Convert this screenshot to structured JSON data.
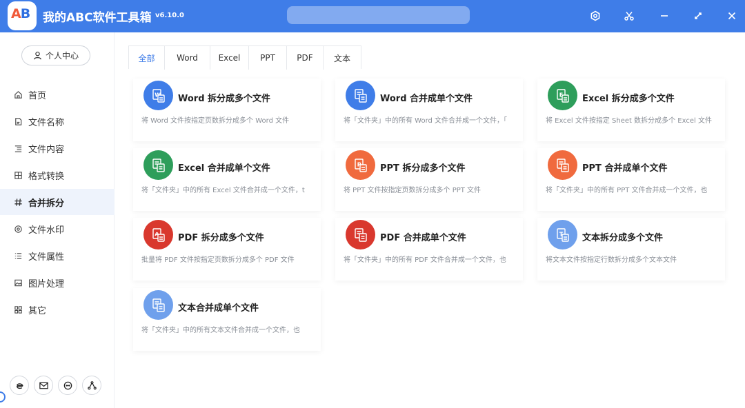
{
  "app": {
    "title": "我的ABC软件工具箱",
    "version": "v6.10.0",
    "logo_text_a": "A",
    "logo_text_b": "B",
    "accent": "#3F7DE8"
  },
  "titlebar_icons": [
    "settings-icon",
    "scissors-icon",
    "minimize-icon",
    "maximize-icon",
    "close-icon"
  ],
  "sidebar": {
    "user_center": "个人中心",
    "items": [
      {
        "label": "首页",
        "icon": "home-icon"
      },
      {
        "label": "文件名称",
        "icon": "file-name-icon"
      },
      {
        "label": "文件内容",
        "icon": "file-content-icon"
      },
      {
        "label": "格式转换",
        "icon": "format-convert-icon"
      },
      {
        "label": "合并拆分",
        "icon": "merge-split-icon",
        "active": true
      },
      {
        "label": "文件水印",
        "icon": "watermark-icon"
      },
      {
        "label": "文件属性",
        "icon": "file-properties-icon"
      },
      {
        "label": "图片处理",
        "icon": "image-process-icon"
      },
      {
        "label": "其它",
        "icon": "other-icon"
      }
    ],
    "bottom_icons": [
      "browser-icon",
      "mail-icon",
      "chat-icon",
      "share-icon"
    ]
  },
  "tabs": [
    {
      "label": "全部",
      "active": true
    },
    {
      "label": "Word"
    },
    {
      "label": "Excel"
    },
    {
      "label": "PPT"
    },
    {
      "label": "PDF"
    },
    {
      "label": "文本"
    }
  ],
  "cards": [
    {
      "title": "Word 拆分成多个文件",
      "desc": "将 Word 文件按指定页数拆分成多个 Word 文件",
      "color": "#3F7DE8",
      "icon": "word-split-icon"
    },
    {
      "title": "Word 合并成单个文件",
      "desc": "将「文件夹」中的所有 Word 文件合并成一个文件，「",
      "color": "#3F7DE8",
      "icon": "word-merge-icon"
    },
    {
      "title": "Excel 拆分成多个文件",
      "desc": "将 Excel 文件按指定 Sheet 数拆分成多个 Excel 文件",
      "color": "#2E9E5B",
      "icon": "excel-split-icon"
    },
    {
      "title": "Excel 合并成单个文件",
      "desc": "将「文件夹」中的所有 Excel 文件合并成一个文件，t",
      "color": "#2E9E5B",
      "icon": "excel-merge-icon"
    },
    {
      "title": "PPT 拆分成多个文件",
      "desc": "将 PPT 文件按指定页数拆分成多个 PPT 文件",
      "color": "#F06A3E",
      "icon": "ppt-split-icon"
    },
    {
      "title": "PPT 合并成单个文件",
      "desc": "将「文件夹」中的所有 PPT 文件合并成一个文件，也",
      "color": "#F06A3E",
      "icon": "ppt-merge-icon"
    },
    {
      "title": "PDF 拆分成多个文件",
      "desc": "批量将 PDF 文件按指定页数拆分成多个 PDF 文件",
      "color": "#D9382E",
      "icon": "pdf-split-icon"
    },
    {
      "title": "PDF 合并成单个文件",
      "desc": "将「文件夹」中的所有 PDF 文件合并成一个文件，也",
      "color": "#D9382E",
      "icon": "pdf-merge-icon"
    },
    {
      "title": "文本拆分成多个文件",
      "desc": "将文本文件按指定行数拆分成多个文本文件",
      "color": "#6FA0EC",
      "icon": "text-split-icon"
    },
    {
      "title": "文本合并成单个文件",
      "desc": "将「文件夹」中的所有文本文件合并成一个文件，也",
      "color": "#6FA0EC",
      "icon": "text-merge-icon"
    }
  ]
}
